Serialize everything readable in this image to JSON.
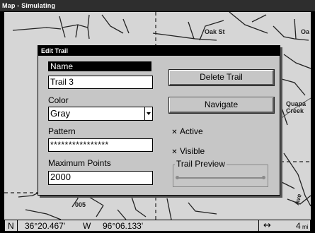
{
  "window": {
    "title": "Map - Simulating"
  },
  "map": {
    "labels": {
      "road_oak": "Oak St",
      "road_oak_edge": "Oa",
      "town": "Quapa",
      "creek": "Creek",
      "route": "005",
      "ave": "Ave"
    }
  },
  "dialog": {
    "title": "Edit Trail",
    "name_label": "Name",
    "name_value": "Trail 3",
    "color_label": "Color",
    "color_value": "Gray",
    "pattern_label": "Pattern",
    "pattern_value": "****************",
    "max_points_label": "Maximum Points",
    "max_points_value": "2000",
    "delete_button": "Delete Trail",
    "navigate_button": "Navigate",
    "active_label": "Active",
    "active_checked": true,
    "visible_label": "Visible",
    "visible_checked": true,
    "preview_label": "Trail Preview",
    "check_glyph": "✕",
    "colors": {
      "preview_line": "#8a8a8a"
    }
  },
  "statusbar": {
    "lat_hemisphere": "N",
    "lat_value": "36°20.467'",
    "lon_hemisphere": "W",
    "lon_value": "96°06.133'",
    "scale_icon": "horizontal-double-arrow-icon",
    "scale_glyph": "↔",
    "scale_value": "4",
    "scale_unit": "mi"
  }
}
